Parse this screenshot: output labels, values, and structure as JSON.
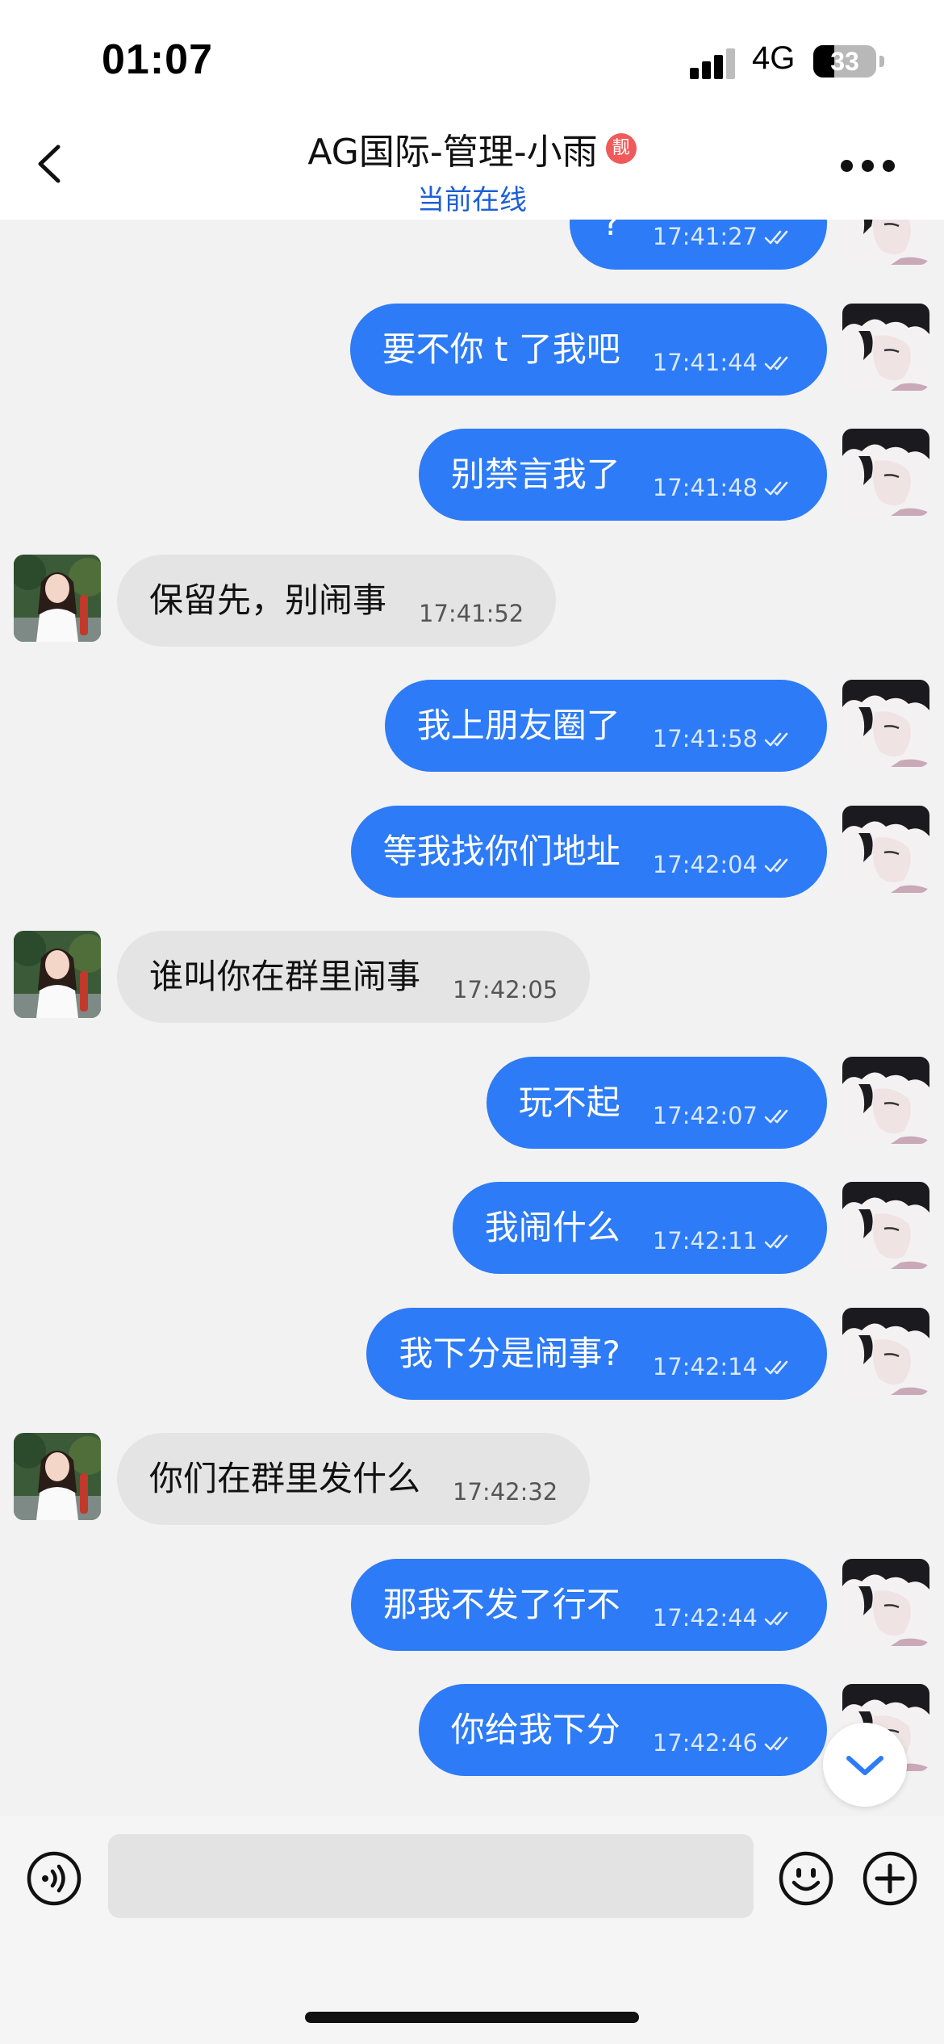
{
  "status_bar": {
    "time": "01:07",
    "network": "4G",
    "battery": "33",
    "battery_fraction": 0.33
  },
  "header": {
    "title": "AG国际-管理-小雨",
    "badge": "靓",
    "status": "当前在线"
  },
  "composer": {
    "placeholder": ""
  },
  "icons": {
    "back": "chevron-left-icon",
    "more": "more-horizontal-icon",
    "read": "double-check-icon",
    "scroll": "chevron-down-icon",
    "voice": "voice-icon",
    "emoji": "emoji-icon",
    "plus": "plus-circle-icon"
  },
  "colors": {
    "outgoing_bubble": "#2d7bf6",
    "incoming_bubble": "#e4e4e4",
    "online_status": "#1d5ed8",
    "badge": "#f05a5a"
  },
  "messages": [
    {
      "direction": "out",
      "text": "?",
      "time": "17:41:27"
    },
    {
      "direction": "out",
      "text": "要不你 t 了我吧",
      "time": "17:41:44"
    },
    {
      "direction": "out",
      "text": "别禁言我了",
      "time": "17:41:48"
    },
    {
      "direction": "in",
      "text": "保留先，别闹事",
      "time": "17:41:52"
    },
    {
      "direction": "out",
      "text": "我上朋友圈了",
      "time": "17:41:58"
    },
    {
      "direction": "out",
      "text": "等我找你们地址",
      "time": "17:42:04"
    },
    {
      "direction": "in",
      "text": "谁叫你在群里闹事",
      "time": "17:42:05"
    },
    {
      "direction": "out",
      "text": "玩不起",
      "time": "17:42:07"
    },
    {
      "direction": "out",
      "text": "我闹什么",
      "time": "17:42:11"
    },
    {
      "direction": "out",
      "text": "我下分是闹事?",
      "time": "17:42:14"
    },
    {
      "direction": "in",
      "text": "你们在群里发什么",
      "time": "17:42:32"
    },
    {
      "direction": "out",
      "text": "那我不发了行不",
      "time": "17:42:44"
    },
    {
      "direction": "out",
      "text": "你给我下分",
      "time": "17:42:46"
    }
  ]
}
